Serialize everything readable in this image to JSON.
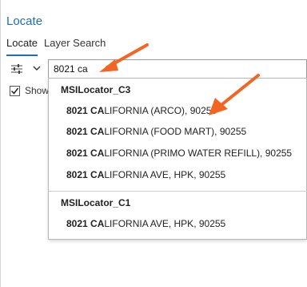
{
  "panel": {
    "title": "Locate"
  },
  "tabs": [
    {
      "label": "Locate",
      "active": true
    },
    {
      "label": "Layer Search",
      "active": false
    }
  ],
  "search": {
    "value": "8021 ca"
  },
  "show_checkbox": {
    "label": "Show",
    "checked": true
  },
  "dropdown": {
    "groups": [
      {
        "name": "MSILocator_C3",
        "items": [
          {
            "match": "8021 CA",
            "rest": "LIFORNIA (ARCO), 90255"
          },
          {
            "match": "8021 CA",
            "rest": "LIFORNIA (FOOD MART), 90255"
          },
          {
            "match": "8021 CA",
            "rest": "LIFORNIA (PRIMO WATER REFILL), 90255"
          },
          {
            "match": "8021 CA",
            "rest": "LIFORNIA AVE, HPK, 90255"
          }
        ]
      },
      {
        "name": "MSILocator_C1",
        "items": [
          {
            "match": "8021 CA",
            "rest": "LIFORNIA AVE, HPK, 90255"
          }
        ]
      }
    ]
  },
  "colors": {
    "accent": "#1e6fb0",
    "annotation_arrow": "#f26522"
  },
  "icons": {
    "options": "sliders-icon",
    "chevron": "chevron-down-icon",
    "check": "checkmark-icon"
  }
}
